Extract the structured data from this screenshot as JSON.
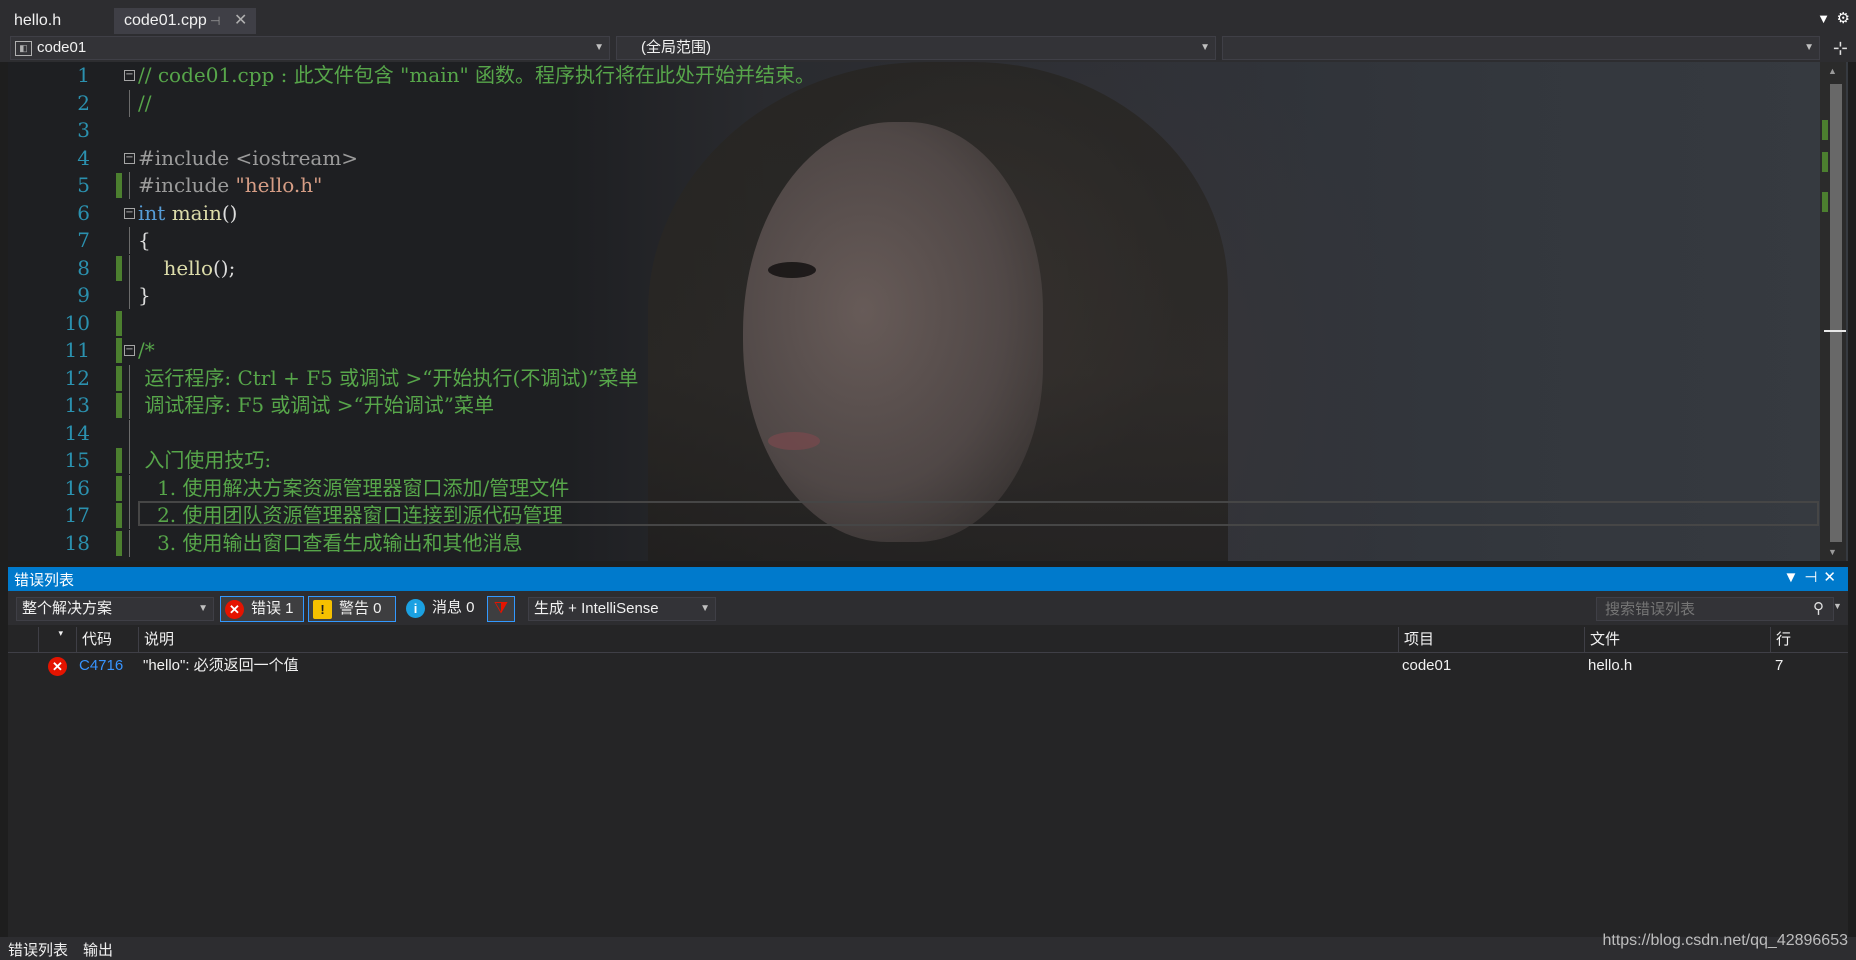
{
  "tabs": [
    {
      "label": "hello.h",
      "active": false
    },
    {
      "label": "code01.cpp",
      "active": true,
      "pinned_icon": "pin-icon",
      "close_icon": "close-icon"
    }
  ],
  "navbar": {
    "project": "code01",
    "scope": "(全局范围)",
    "member": ""
  },
  "editor": {
    "lines": [
      {
        "n": "1",
        "fold": "⊟",
        "changed": false,
        "parts": [
          {
            "t": "// code01.cpp : 此文件包含 \"main\" 函数。程序执行将在此处开始并结束。",
            "c": "comment"
          }
        ]
      },
      {
        "n": "2",
        "fold": "",
        "changed": false,
        "parts": [
          {
            "t": "//",
            "c": "comment"
          }
        ]
      },
      {
        "n": "3",
        "fold": "",
        "changed": false,
        "parts": []
      },
      {
        "n": "4",
        "fold": "⊟",
        "changed": false,
        "parts": [
          {
            "t": "#include <iostream>",
            "c": "pre"
          }
        ]
      },
      {
        "n": "5",
        "fold": "",
        "changed": true,
        "parts": [
          {
            "t": "#include ",
            "c": "pre"
          },
          {
            "t": "\"hello.h\"",
            "c": "str"
          }
        ]
      },
      {
        "n": "6",
        "fold": "⊟",
        "changed": false,
        "parts": [
          {
            "t": "int",
            "c": "kw"
          },
          {
            "t": " ",
            "c": "plain"
          },
          {
            "t": "main",
            "c": "fn"
          },
          {
            "t": "()",
            "c": "plain"
          }
        ]
      },
      {
        "n": "7",
        "fold": "",
        "changed": false,
        "parts": [
          {
            "t": "{",
            "c": "plain"
          }
        ]
      },
      {
        "n": "8",
        "fold": "",
        "changed": true,
        "parts": [
          {
            "t": "    ",
            "c": "plain"
          },
          {
            "t": "hello",
            "c": "fn"
          },
          {
            "t": "();",
            "c": "plain"
          }
        ]
      },
      {
        "n": "9",
        "fold": "",
        "changed": false,
        "parts": [
          {
            "t": "}",
            "c": "plain"
          }
        ]
      },
      {
        "n": "10",
        "fold": "",
        "changed": true,
        "parts": []
      },
      {
        "n": "11",
        "fold": "⊟",
        "changed": true,
        "parts": [
          {
            "t": "/*",
            "c": "comment"
          }
        ]
      },
      {
        "n": "12",
        "fold": "",
        "changed": true,
        "parts": [
          {
            "t": " 运行程序: Ctrl + F5 或调试 >“开始执行(不调试)”菜单",
            "c": "comment"
          }
        ]
      },
      {
        "n": "13",
        "fold": "",
        "changed": true,
        "parts": [
          {
            "t": " 调试程序: F5 或调试 >“开始调试”菜单",
            "c": "comment"
          }
        ]
      },
      {
        "n": "14",
        "fold": "",
        "changed": false,
        "parts": []
      },
      {
        "n": "15",
        "fold": "",
        "changed": true,
        "parts": [
          {
            "t": " 入门使用技巧:",
            "c": "comment"
          }
        ]
      },
      {
        "n": "16",
        "fold": "",
        "changed": true,
        "parts": [
          {
            "t": "   1. 使用解决方案资源管理器窗口添加/管理文件",
            "c": "comment"
          }
        ]
      },
      {
        "n": "17",
        "fold": "",
        "changed": true,
        "parts": [
          {
            "t": "   2. 使用团队资源管理器窗口连接到源代码管理",
            "c": "comment"
          }
        ]
      },
      {
        "n": "18",
        "fold": "",
        "changed": true,
        "parts": [
          {
            "t": "   3. 使用输出窗口查看生成输出和其他消息",
            "c": "comment"
          }
        ]
      }
    ]
  },
  "error_list": {
    "title": "错误列表",
    "scope_value": "整个解决方案",
    "errors_label": "错误 1",
    "warnings_label": "警告 0",
    "messages_label": "消息 0",
    "build_value": "生成 + IntelliSense",
    "search_placeholder": "搜索错误列表",
    "columns": {
      "code": "代码",
      "description": "说明",
      "project": "项目",
      "file": "文件",
      "line": "行"
    },
    "rows": [
      {
        "code": "C4716",
        "description": "\"hello\": 必须返回一个值",
        "project": "code01",
        "file": "hello.h",
        "line": "7"
      }
    ]
  },
  "bottom_tabs": [
    "错误列表",
    "输出"
  ],
  "watermark": "https://blog.csdn.net/qq_42896653",
  "colors": {
    "accent": "#007acc",
    "comment": "#57a64a",
    "keyword": "#569cd6",
    "error": "#e51400"
  }
}
